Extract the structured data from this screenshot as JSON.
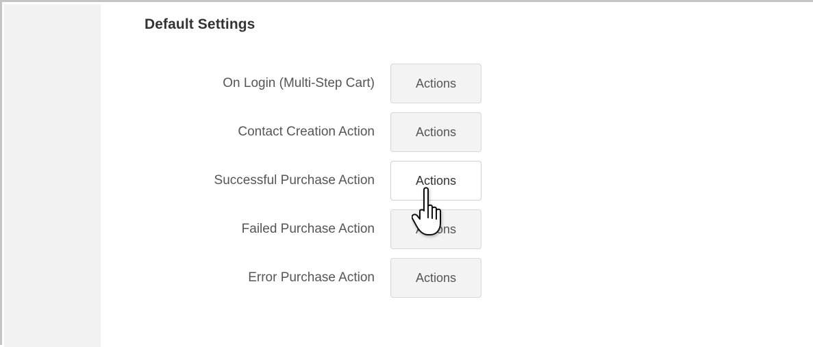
{
  "section": {
    "title": "Default Settings"
  },
  "rows": [
    {
      "label": "On Login (Multi-Step Cart)",
      "button": "Actions"
    },
    {
      "label": "Contact Creation Action",
      "button": "Actions"
    },
    {
      "label": "Successful Purchase Action",
      "button": "Actions"
    },
    {
      "label": "Failed Purchase Action",
      "button": "Actions"
    },
    {
      "label": "Error Purchase Action",
      "button": "Actions"
    }
  ],
  "cursor": {
    "icon": "hand-pointer-icon"
  },
  "colors": {
    "border": "#c4c4c4",
    "rail": "#f2f2f2",
    "button_bg": "#f3f3f3",
    "button_hover_bg": "#ffffff",
    "label_text": "#555555",
    "title_text": "#333333"
  }
}
